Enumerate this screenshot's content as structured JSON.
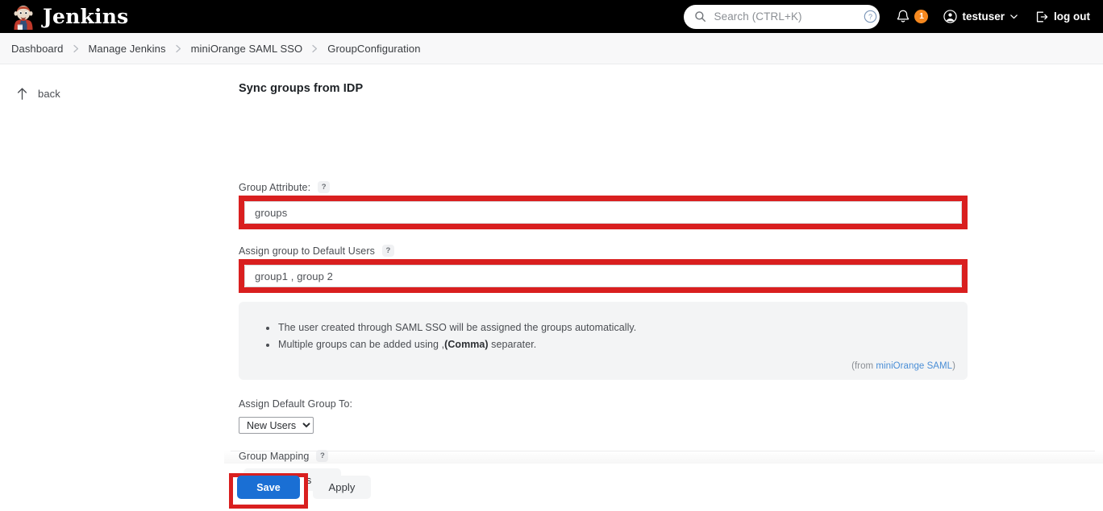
{
  "header": {
    "brand_name": "Jenkins",
    "brand_logo_icon": "jenkins-butler-logo",
    "search": {
      "placeholder": "Search (CTRL+K)",
      "value": "",
      "search_icon": "search-icon",
      "help_icon": "question-circle-icon"
    },
    "notifications": {
      "bell_icon": "bell-icon",
      "count": "1",
      "badge_color": "#f5881f"
    },
    "user": {
      "label": "testuser",
      "avatar_icon": "user-circle-icon",
      "chevron_icon": "chevron-down-icon"
    },
    "logout": {
      "label": "log out",
      "icon": "logout-icon"
    }
  },
  "breadcrumb": {
    "separator": "›",
    "items": [
      {
        "label": "Dashboard"
      },
      {
        "label": "Manage Jenkins"
      },
      {
        "label": "miniOrange SAML SSO"
      },
      {
        "label": "GroupConfiguration"
      }
    ]
  },
  "sidebar": {
    "back": {
      "label": "back",
      "icon": "arrow-up-icon"
    }
  },
  "main": {
    "section_title": "Sync groups from IDP",
    "group_attribute": {
      "label": "Group Attribute:",
      "help_icon": "question-mark-icon",
      "help_glyph": "?",
      "value": "groups",
      "placeholder": "",
      "highlight_color": "#d91f1f"
    },
    "assign_default_users": {
      "label": "Assign group to Default Users",
      "help_icon": "question-mark-icon",
      "help_glyph": "?",
      "value": "group1 , group 2",
      "placeholder": "",
      "highlight_color": "#d91f1f"
    },
    "info_panel": {
      "bullets": [
        {
          "text_before": "The user created through SAML SSO will be assigned the groups automatically.",
          "bold": "",
          "text_after": ""
        },
        {
          "text_before": "Multiple groups can be added using ,",
          "bold": "(Comma)",
          "text_after": " separater."
        }
      ],
      "attribution_prefix": "(from ",
      "attribution_link": "miniOrange SAML",
      "attribution_suffix": ")"
    },
    "assign_default_group_to": {
      "label": "Assign Default Group To:",
      "selected": "New Users",
      "options": [
        "New Users"
      ]
    },
    "group_mapping": {
      "label": "Group Mapping",
      "help_icon": "question-mark-icon",
      "help_glyph": "?",
      "add_groups_label": "Add Groups",
      "chevron_icon": "chevron-down-icon"
    }
  },
  "footer": {
    "save_label": "Save",
    "save_color": "#1a6fd4",
    "save_highlight_color": "#d91f1f",
    "apply_label": "Apply"
  }
}
